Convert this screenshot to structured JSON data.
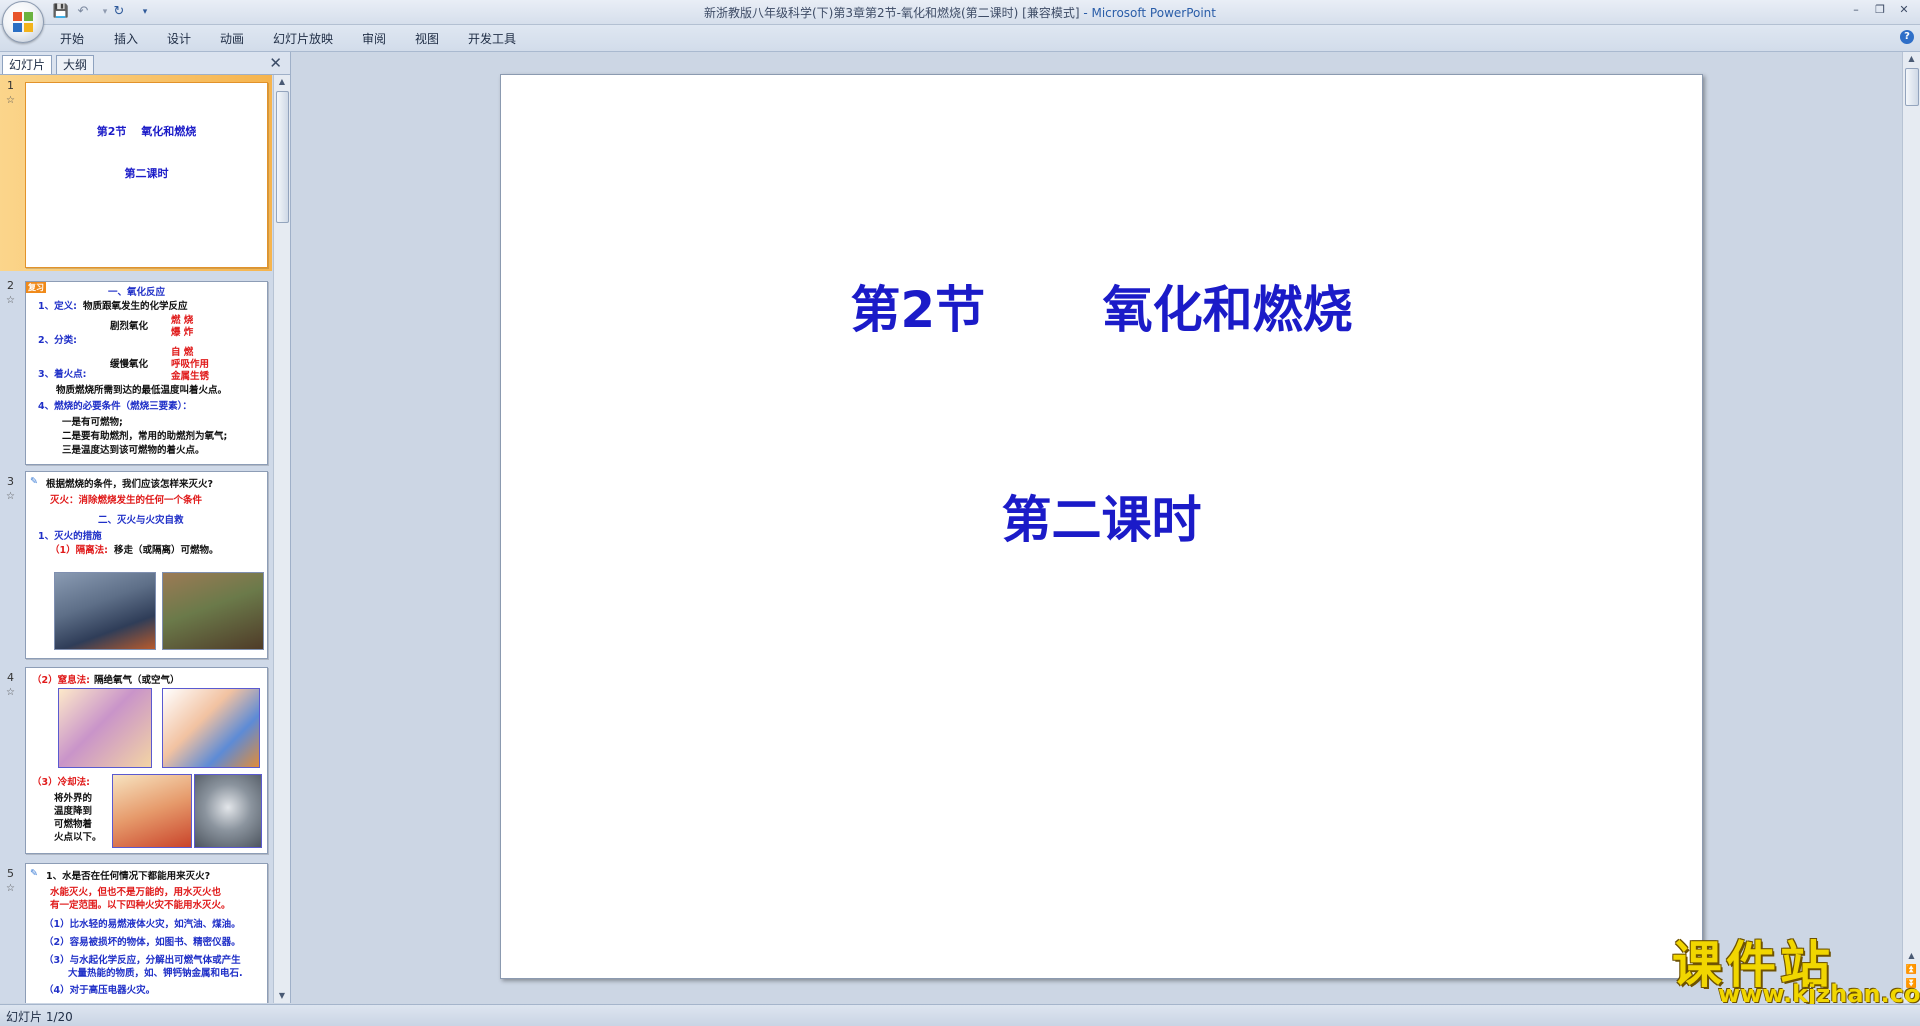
{
  "window": {
    "title": "新浙教版八年级科学(下)第3章第2节-氧化和燃烧(第二课时) [兼容模式]",
    "app_name": "- Microsoft PowerPoint"
  },
  "ribbon_tabs": [
    "开始",
    "插入",
    "设计",
    "动画",
    "幻灯片放映",
    "审阅",
    "视图",
    "开发工具"
  ],
  "pane_tabs": {
    "slides": "幻灯片",
    "outline": "大纲"
  },
  "thumbnails": {
    "s1": {
      "num": "1",
      "title": "第2节　 氧化和燃烧",
      "subtitle": "第二课时"
    },
    "s2": {
      "num": "2",
      "badge": "复习",
      "heading": "一、氧化反应",
      "l1a": "1、定义:",
      "l1b": "物质跟氧发生的化学反应",
      "l2": "2、分类:",
      "b1": "剧烈氧化",
      "b1a": "燃 烧",
      "b1b": "爆 炸",
      "b2": "缓慢氧化",
      "b2a": "自 燃",
      "b2b": "呼吸作用",
      "b2c": "金属生锈",
      "l3": "3、着火点:",
      "l3b": "物质燃烧所需到达的最低温度叫着火点。",
      "l4": "4、燃烧的必要条件（燃烧三要素）：",
      "c1": "一是有可燃物;",
      "c2": "二是要有助燃剂，常用的助燃剂为氧气;",
      "c3": "三是温度达到该可燃物的着火点。"
    },
    "s3": {
      "num": "3",
      "q": "根据燃烧的条件，我们应该怎样来灭火?",
      "a": "灭火：消除燃烧发生的任何一个条件",
      "heading": "二、灭火与火灾自救",
      "l1": "1、灭火的措施",
      "l2a": "（1）隔离法:",
      "l2b": "移走（或隔离）可燃物。"
    },
    "s4": {
      "num": "4",
      "l1a": "（2）窒息法:",
      "l1b": "隔绝氧气（或空气）",
      "l2": "（3）冷却法:",
      "l3": "将外界的",
      "l4": "温度降到",
      "l5": "可燃物着",
      "l6": "火点以下。"
    },
    "s5": {
      "num": "5",
      "q": "1、水是否在任何情况下都能用来灭火?",
      "a1": "水能灭火，但也不是万能的，用水灭火也",
      "a2": "有一定范围。以下四种火灾不能用水灭火。",
      "p1": "（1）比水轻的易燃液体火灾，如汽油、煤油。",
      "p2": "（2）容易被损坏的物体，如图书、精密仪器。",
      "p3": "（3）与水起化学反应，分解出可燃气体或产生",
      "p3b": "大量热能的物质，如、钾钙钠金属和电石.",
      "p4": "（4）对于高压电器火灾。"
    }
  },
  "slide": {
    "title": "第2节　　 氧化和燃烧",
    "subtitle": "第二课时"
  },
  "watermark": {
    "title": "课件站",
    "url": "www.kjzhan.com"
  },
  "status": {
    "text": "幻灯片 1/20"
  },
  "colors": {
    "slide_text": "#1b1bc8",
    "thumb_red": "#e01a1a",
    "selected_row": "#f6b44d"
  }
}
